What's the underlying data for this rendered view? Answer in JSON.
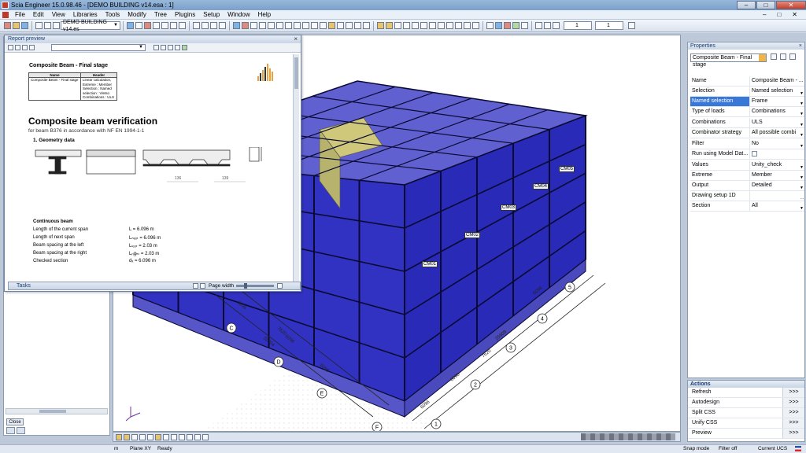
{
  "window": {
    "title": "Scia Engineer 15.0.98.46 - [DEMO BUILDING v14.esa : 1]",
    "minimize": "–",
    "maximize": "□",
    "close": "✕"
  },
  "menu": [
    "File",
    "Edit",
    "View",
    "Libraries",
    "Tools",
    "Modify",
    "Tree",
    "Plugins",
    "Setup",
    "Window",
    "Help"
  ],
  "mdi_buttons": [
    "–",
    "□",
    "✕"
  ],
  "toolbar": {
    "project_combo": "DEMO BUILDING v14.es",
    "spin1": "1",
    "spin2": "1"
  },
  "report": {
    "header": "Report preview",
    "close": "×",
    "section_title": "Composite Beam - Final stage",
    "table": {
      "headers": [
        "Name",
        "Header"
      ],
      "row": {
        "name": "Composite Beam - Final stage",
        "header_lines": [
          "Linear calculation,",
          "Extreme : Member",
          "Selection : Named",
          "selection : Vletso",
          "Combinations : ULS"
        ]
      }
    },
    "big_title": "Composite beam verification",
    "subtitle": "for beam B376 in accordance with NF EN 1994-1-1",
    "geometry_heading": "1. Geometry data",
    "dim_labels": [
      "136",
      "139"
    ],
    "continuous_beam": "Continuous beam",
    "rows": [
      {
        "label": "Length of the current span",
        "value": "L = 6.096 m"
      },
      {
        "label": "Length of next span",
        "value": "Lₙₑₓₜ = 6.096 m"
      },
      {
        "label": "Beam spacing at the left",
        "value": "Lₗₑₒₜ = 2.03 m"
      },
      {
        "label": "Beam spacing at the right",
        "value": "Lᵣᵢgₕₜ = 2.03 m"
      },
      {
        "label": "Checked section",
        "value": "dₓ = 6.096 m"
      }
    ],
    "tasks": "Tasks",
    "page_width": "Page width"
  },
  "left_panel": {
    "close_button": "Close"
  },
  "viewport": {
    "member_labels": [
      "CM01",
      "CM02",
      "CM03",
      "CM04",
      "CM05"
    ],
    "grid_lines": [
      "1",
      "2",
      "3",
      "4",
      "5",
      "C",
      "D",
      "E",
      "F"
    ],
    "dimension_texts": [
      "6096",
      "6096",
      "6096",
      "7620",
      "32004",
      "6096",
      "6096",
      "7620",
      "25908",
      "6096"
    ]
  },
  "properties": {
    "header": "Properties",
    "close": "×",
    "selector": "Composite Beam - Final stage",
    "rows": [
      {
        "key": "Name",
        "value": "Composite Beam - ...",
        "dd": "",
        "selected": false
      },
      {
        "key": "Selection",
        "value": "Named selection",
        "dd": "▼",
        "selected": false
      },
      {
        "key": "Named selection",
        "value": "Frame",
        "dd": "▼",
        "selected": true
      },
      {
        "key": "Type of loads",
        "value": "Combinations",
        "dd": "▼",
        "selected": false
      },
      {
        "key": "Combinations",
        "value": "ULS",
        "dd": "▼",
        "selected": false
      },
      {
        "key": "Combinator strategy",
        "value": "All possible combi",
        "dd": "▼",
        "selected": false
      },
      {
        "key": "Filter",
        "value": "No",
        "dd": "▼",
        "selected": false
      },
      {
        "key": "Run using Model Dat...",
        "value": "",
        "dd": "",
        "selected": false
      },
      {
        "key": "Values",
        "value": "Unity_check",
        "dd": "▼",
        "selected": false
      },
      {
        "key": "Extreme",
        "value": "Member",
        "dd": "▼",
        "selected": false
      },
      {
        "key": "Output",
        "value": "Detailed",
        "dd": "▼",
        "selected": false
      },
      {
        "key": "Drawing setup 1D",
        "value": "",
        "dd": "...",
        "selected": false
      },
      {
        "key": "Section",
        "value": "All",
        "dd": "▼",
        "selected": false
      }
    ]
  },
  "actions": {
    "header": "Actions",
    "items": [
      {
        "label": "Refresh",
        "button": ">>>"
      },
      {
        "label": "Autodesign",
        "button": ">>>"
      },
      {
        "label": "Split CSS",
        "button": ">>>"
      },
      {
        "label": "Unify CSS",
        "button": ">>>"
      },
      {
        "label": "Preview",
        "button": ">>>"
      }
    ]
  },
  "status": {
    "units": "m",
    "plane": "Plane XY",
    "ready": "Ready",
    "snap": "Snap mode",
    "filter": "Filter off",
    "ucs": "Current UCS"
  },
  "colors": {
    "structure_fill": "#1e1ea8",
    "structure_edge": "#0a0a33",
    "core_fill": "#cfc77a",
    "selection_blue": "#3a78d8"
  }
}
